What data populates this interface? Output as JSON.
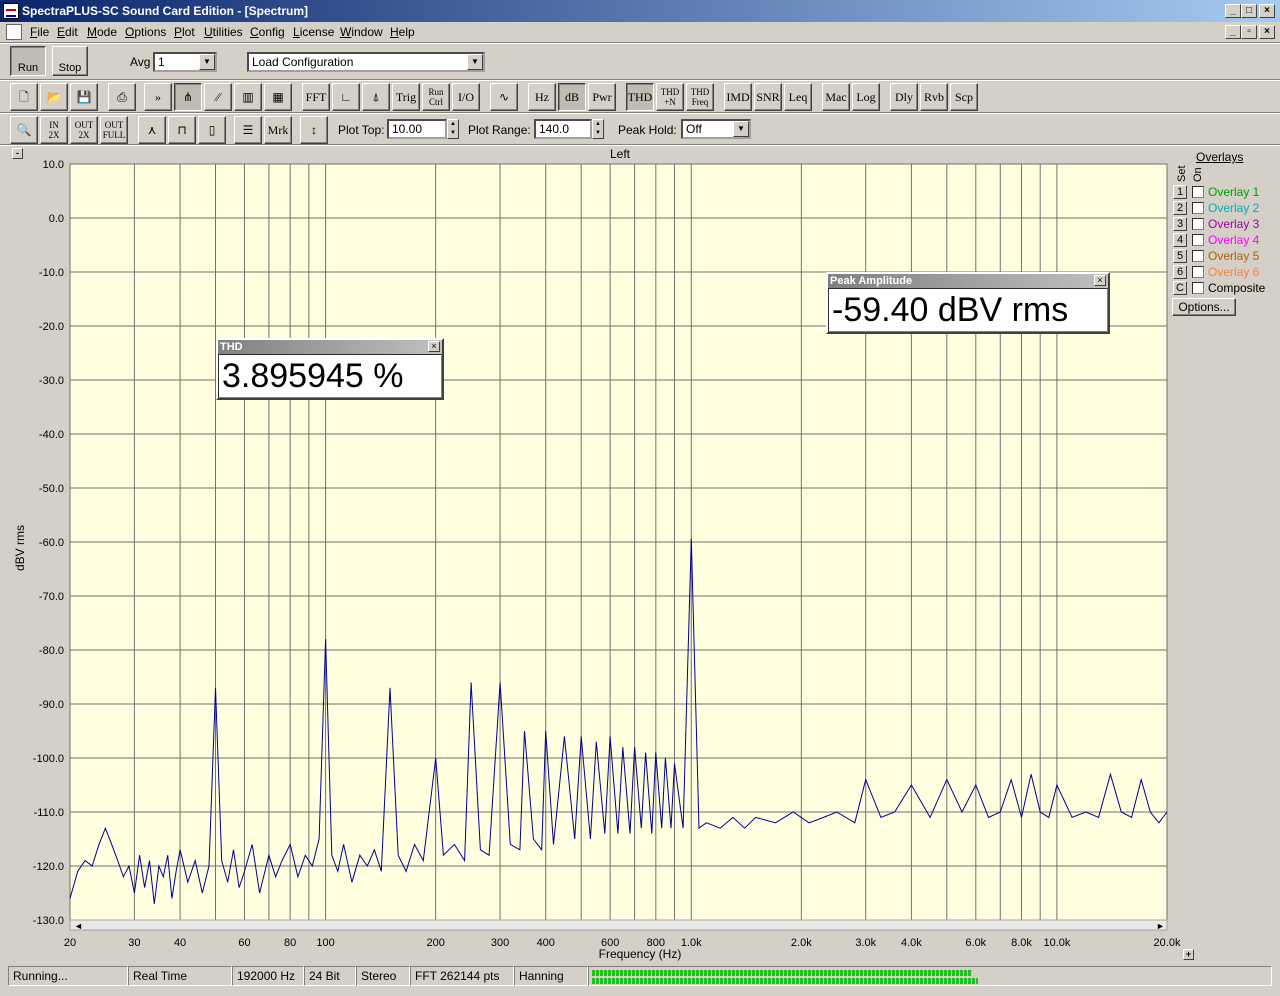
{
  "window": {
    "title": "SpectraPLUS-SC Sound Card Edition - [Spectrum]"
  },
  "menu": [
    "File",
    "Edit",
    "Mode",
    "Options",
    "Plot",
    "Utilities",
    "Config",
    "License",
    "Window",
    "Help"
  ],
  "toolbar1": {
    "run_label": "Run",
    "stop_label": "Stop",
    "avg_label": "Avg",
    "avg_value": "1",
    "config_value": "Load Configuration"
  },
  "toolbar2": [
    "FFT",
    "Trig",
    "Run Ctrl",
    "I/O",
    "Hz",
    "dB",
    "Pwr",
    "THD",
    "THD +N",
    "THD Freq",
    "IMD",
    "SNR",
    "Leq",
    "Mac",
    "Log",
    "Dly",
    "Rvb",
    "Scp"
  ],
  "toolbar3": {
    "mrk_label": "Mrk",
    "plot_top_label": "Plot Top:",
    "plot_top_value": "10.00",
    "plot_range_label": "Plot Range:",
    "plot_range_value": "140.0",
    "peak_hold_label": "Peak Hold:",
    "peak_hold_value": "Off"
  },
  "chart_data": {
    "type": "line",
    "title": "Left",
    "xlabel": "Frequency (Hz)",
    "ylabel": "dBV rms",
    "xscale": "log",
    "xlim": [
      20,
      20000
    ],
    "ylim": [
      -130,
      10
    ],
    "x_ticks": [
      {
        "v": 20,
        "t": "20"
      },
      {
        "v": 30,
        "t": "30"
      },
      {
        "v": 40,
        "t": "40"
      },
      {
        "v": 60,
        "t": "60"
      },
      {
        "v": 80,
        "t": "80"
      },
      {
        "v": 100,
        "t": "100"
      },
      {
        "v": 200,
        "t": "200"
      },
      {
        "v": 300,
        "t": "300"
      },
      {
        "v": 400,
        "t": "400"
      },
      {
        "v": 600,
        "t": "600"
      },
      {
        "v": 800,
        "t": "800"
      },
      {
        "v": 1000,
        "t": "1.0k"
      },
      {
        "v": 2000,
        "t": "2.0k"
      },
      {
        "v": 3000,
        "t": "3.0k"
      },
      {
        "v": 4000,
        "t": "4.0k"
      },
      {
        "v": 6000,
        "t": "6.0k"
      },
      {
        "v": 8000,
        "t": "8.0k"
      },
      {
        "v": 10000,
        "t": "10.0k"
      },
      {
        "v": 20000,
        "t": "20.0k"
      }
    ],
    "y_ticks": [
      "10.0",
      "0.0",
      "-10.0",
      "-20.0",
      "-30.0",
      "-40.0",
      "-50.0",
      "-60.0",
      "-70.0",
      "-80.0",
      "-90.0",
      "-100.0",
      "-110.0",
      "-120.0",
      "-130.0"
    ],
    "series": [
      {
        "color": "#00008b",
        "points": [
          [
            20,
            -126
          ],
          [
            21,
            -121
          ],
          [
            22,
            -119
          ],
          [
            23,
            -120
          ],
          [
            24,
            -116
          ],
          [
            25,
            -113
          ],
          [
            26,
            -116
          ],
          [
            27,
            -119
          ],
          [
            28,
            -122
          ],
          [
            29,
            -120
          ],
          [
            30,
            -125
          ],
          [
            31,
            -118
          ],
          [
            32,
            -124
          ],
          [
            33,
            -119
          ],
          [
            34,
            -127
          ],
          [
            35,
            -120
          ],
          [
            36,
            -122
          ],
          [
            37,
            -118
          ],
          [
            38,
            -126
          ],
          [
            39,
            -121
          ],
          [
            40,
            -117
          ],
          [
            42,
            -123
          ],
          [
            44,
            -119
          ],
          [
            46,
            -125
          ],
          [
            48,
            -120
          ],
          [
            50,
            -87
          ],
          [
            52,
            -119
          ],
          [
            54,
            -123
          ],
          [
            56,
            -117
          ],
          [
            58,
            -124
          ],
          [
            60,
            -121
          ],
          [
            63,
            -116
          ],
          [
            66,
            -125
          ],
          [
            70,
            -118
          ],
          [
            73,
            -122
          ],
          [
            76,
            -119
          ],
          [
            80,
            -116
          ],
          [
            84,
            -122
          ],
          [
            88,
            -118
          ],
          [
            92,
            -120
          ],
          [
            96,
            -115
          ],
          [
            100,
            -78
          ],
          [
            104,
            -118
          ],
          [
            108,
            -121
          ],
          [
            112,
            -116
          ],
          [
            118,
            -123
          ],
          [
            124,
            -118
          ],
          [
            130,
            -120
          ],
          [
            136,
            -117
          ],
          [
            142,
            -121
          ],
          [
            150,
            -87
          ],
          [
            158,
            -118
          ],
          [
            166,
            -121
          ],
          [
            175,
            -116
          ],
          [
            185,
            -119
          ],
          [
            200,
            -100
          ],
          [
            210,
            -118
          ],
          [
            225,
            -116
          ],
          [
            240,
            -119
          ],
          [
            250,
            -86
          ],
          [
            265,
            -117
          ],
          [
            280,
            -118
          ],
          [
            300,
            -86
          ],
          [
            320,
            -116
          ],
          [
            340,
            -117
          ],
          [
            350,
            -95
          ],
          [
            370,
            -115
          ],
          [
            390,
            -117
          ],
          [
            400,
            -95
          ],
          [
            420,
            -116
          ],
          [
            450,
            -96
          ],
          [
            480,
            -115
          ],
          [
            500,
            -96
          ],
          [
            530,
            -115
          ],
          [
            550,
            -97
          ],
          [
            580,
            -114
          ],
          [
            600,
            -96
          ],
          [
            630,
            -114
          ],
          [
            650,
            -98
          ],
          [
            680,
            -114
          ],
          [
            700,
            -98
          ],
          [
            730,
            -113
          ],
          [
            750,
            -99
          ],
          [
            780,
            -114
          ],
          [
            800,
            -99
          ],
          [
            830,
            -113
          ],
          [
            850,
            -100
          ],
          [
            880,
            -113
          ],
          [
            900,
            -101
          ],
          [
            950,
            -113
          ],
          [
            1000,
            -59.4
          ],
          [
            1050,
            -113
          ],
          [
            1100,
            -112
          ],
          [
            1200,
            -113
          ],
          [
            1300,
            -111
          ],
          [
            1400,
            -113
          ],
          [
            1500,
            -111
          ],
          [
            1700,
            -112
          ],
          [
            1900,
            -110
          ],
          [
            2100,
            -112
          ],
          [
            2300,
            -111
          ],
          [
            2500,
            -110
          ],
          [
            2800,
            -112
          ],
          [
            3000,
            -104
          ],
          [
            3300,
            -111
          ],
          [
            3600,
            -110
          ],
          [
            4000,
            -105
          ],
          [
            4500,
            -111
          ],
          [
            5000,
            -104
          ],
          [
            5500,
            -110
          ],
          [
            6000,
            -105
          ],
          [
            6500,
            -111
          ],
          [
            7000,
            -110
          ],
          [
            7500,
            -104
          ],
          [
            8000,
            -111
          ],
          [
            8500,
            -103
          ],
          [
            9000,
            -110
          ],
          [
            9500,
            -111
          ],
          [
            10000,
            -105
          ],
          [
            11000,
            -111
          ],
          [
            12000,
            -110
          ],
          [
            13000,
            -111
          ],
          [
            14000,
            -103
          ],
          [
            15000,
            -110
          ],
          [
            16000,
            -111
          ],
          [
            17000,
            -104
          ],
          [
            18000,
            -110
          ],
          [
            19000,
            -112
          ],
          [
            20000,
            -110
          ]
        ]
      }
    ]
  },
  "thd_window": {
    "title": "THD",
    "value": "3.895945 %"
  },
  "peak_window": {
    "title": "Peak Amplitude",
    "value": "-59.40 dBV rms"
  },
  "overlays": {
    "title": "Overlays",
    "set_label": "Set",
    "on_label": "On",
    "options_label": "Options...",
    "items": [
      {
        "num": "1",
        "name": "Overlay 1",
        "color": "#00a000"
      },
      {
        "num": "2",
        "name": "Overlay 2",
        "color": "#00b0b0"
      },
      {
        "num": "3",
        "name": "Overlay 3",
        "color": "#a000a0"
      },
      {
        "num": "4",
        "name": "Overlay 4",
        "color": "#ff00ff"
      },
      {
        "num": "5",
        "name": "Overlay 5",
        "color": "#b06000"
      },
      {
        "num": "6",
        "name": "Overlay 6",
        "color": "#ff8040"
      },
      {
        "num": "C",
        "name": "Composite",
        "color": "#000000"
      }
    ]
  },
  "status": [
    "Running...",
    "Real Time",
    "192000 Hz",
    "24 Bit",
    "Stereo",
    "FFT 262144 pts",
    "Hanning"
  ]
}
